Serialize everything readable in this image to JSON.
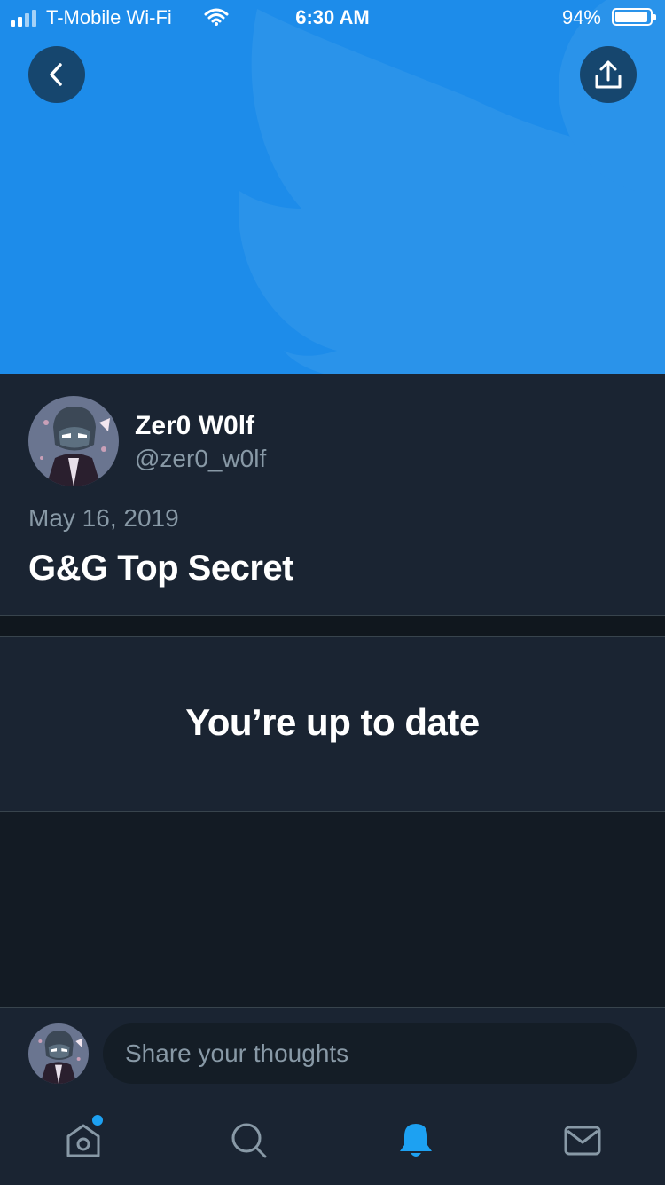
{
  "status_bar": {
    "carrier": "T-Mobile Wi-Fi",
    "time": "6:30 AM",
    "battery": "94%"
  },
  "header": {
    "back_icon": "chevron-left-icon",
    "share_icon": "share-icon",
    "banner_color": "#1d8cea"
  },
  "moment": {
    "author_name": "Zer0 W0lf",
    "author_handle": "@zer0_w0lf",
    "date": "May 16, 2019",
    "title": "G&G Top Secret"
  },
  "feed": {
    "status_message": "You’re up to date"
  },
  "compose": {
    "placeholder": "Share your thoughts"
  },
  "tab_bar": {
    "items": [
      {
        "name": "home",
        "icon": "home-icon",
        "has_badge": true
      },
      {
        "name": "search",
        "icon": "search-icon"
      },
      {
        "name": "notifications",
        "icon": "bell-icon",
        "active": true
      },
      {
        "name": "messages",
        "icon": "mail-icon"
      }
    ],
    "active_color": "#1da1f2",
    "inactive_color": "#8899a6"
  }
}
